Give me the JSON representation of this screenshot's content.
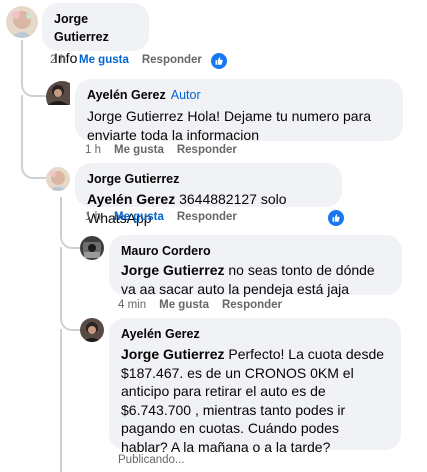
{
  "colors": {
    "like_blue": "#0064d1",
    "bubble": "#f0f2f5",
    "meta_gray": "#65676b",
    "thread_line": "#ced0d4"
  },
  "comments": [
    {
      "author": "Jorge Gutierrez",
      "text": "Info",
      "time": "2 h",
      "like": "Me gusta",
      "reply": "Responder",
      "reaction": "like-icon"
    },
    {
      "author": "Ayelén Gerez",
      "badge": "Autor",
      "mention": "Jorge Gutierrez",
      "text": "Hola! Dejame tu numero para enviarte toda la informacion",
      "time": "1 h",
      "like": "Me gusta",
      "reply": "Responder"
    },
    {
      "author": "Jorge Gutierrez",
      "mention": "Ayelén Gerez",
      "text": "3644882127 solo WhatsApp",
      "time": "1 h",
      "like": "Me gusta",
      "reply": "Responder",
      "reaction": "like-icon"
    },
    {
      "author": "Mauro Cordero",
      "mention": "Jorge Gutierrez",
      "text": "no seas tonto de dónde va aa sacar auto la pendeja está jaja",
      "time": "4 min",
      "like": "Me gusta",
      "reply": "Responder"
    },
    {
      "author": "Ayelén Gerez",
      "mention": "Jorge Gutierrez",
      "text": "Perfecto! La cuota desde $187.467. es de un CRONOS 0KM el anticipo para retirar el auto es de $6.743.700 , mientras tanto podes ir pagando en cuotas. Cuándo podes hablar? A la mañana o a la tarde?",
      "status": "Publicando..."
    }
  ]
}
